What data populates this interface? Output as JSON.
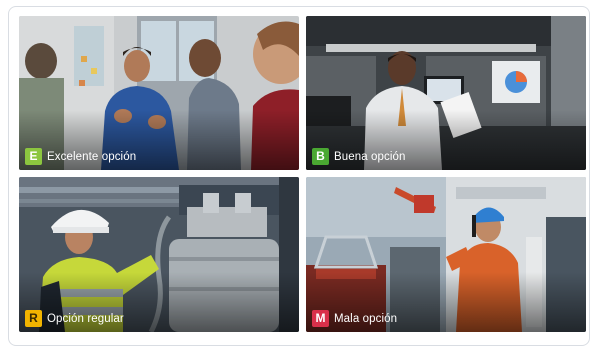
{
  "options": [
    {
      "letter": "E",
      "label": "Excelente opción",
      "color": "#8cc63f",
      "icon": "excellent-badge"
    },
    {
      "letter": "B",
      "label": "Buena opción",
      "color": "#4aa832",
      "icon": "good-badge"
    },
    {
      "letter": "R",
      "label": "Opción regular",
      "color": "#f2b400",
      "icon": "regular-badge"
    },
    {
      "letter": "M",
      "label": "Mala opción",
      "color": "#d9304a",
      "icon": "bad-badge"
    }
  ]
}
